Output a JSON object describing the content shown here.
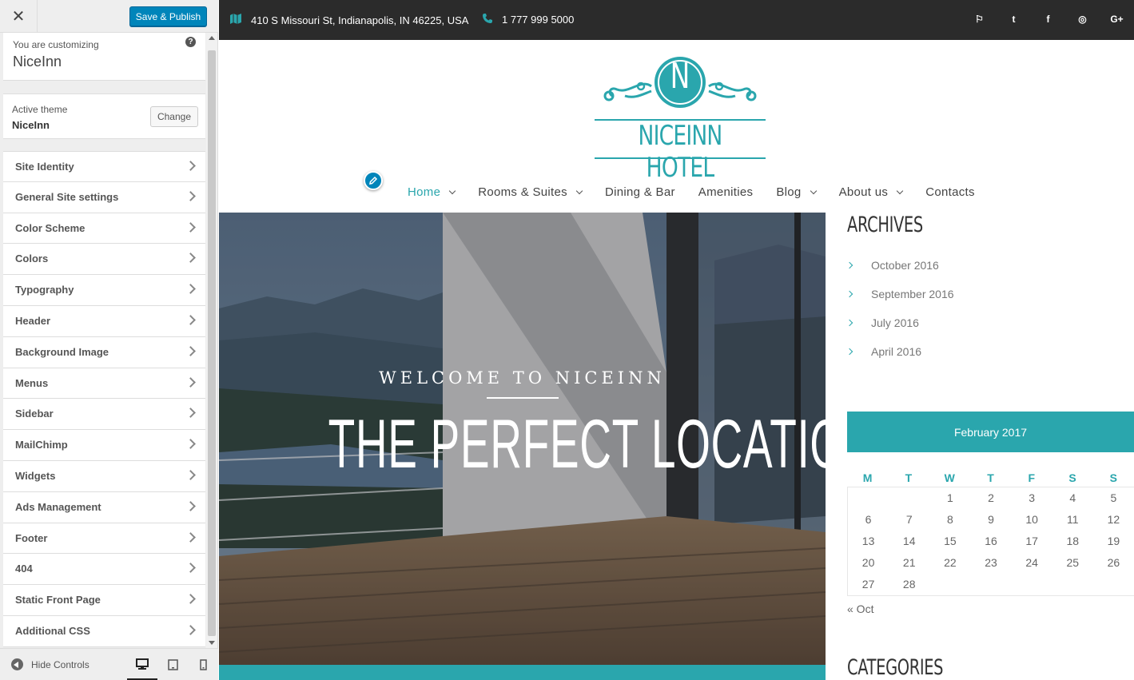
{
  "customizer": {
    "close_icon": "close-icon",
    "save_label": "Save & Publish",
    "info_subtitle": "You are customizing",
    "info_title": "NiceInn",
    "help_icon": "help-icon",
    "theme_subtitle": "Active theme",
    "theme_name": "NiceInn",
    "change_label": "Change",
    "sections": [
      {
        "label": "Site Identity"
      },
      {
        "label": "General Site settings"
      },
      {
        "label": "Color Scheme"
      },
      {
        "label": "Colors"
      },
      {
        "label": "Typography"
      },
      {
        "label": "Header"
      },
      {
        "label": "Background Image"
      },
      {
        "label": "Menus"
      },
      {
        "label": "Sidebar"
      },
      {
        "label": "MailChimp"
      },
      {
        "label": "Widgets"
      },
      {
        "label": "Ads Management"
      },
      {
        "label": "Footer"
      },
      {
        "label": "404"
      },
      {
        "label": "Static Front Page"
      },
      {
        "label": "Additional CSS"
      }
    ],
    "hide_controls_label": "Hide Controls",
    "devices": [
      "desktop-icon",
      "tablet-icon",
      "mobile-icon"
    ],
    "active_device": "desktop"
  },
  "site": {
    "address": "410 S Missouri St, Indianapolis, IN 46225, USA",
    "phone": "1 777 999 5000",
    "social_icons": [
      "foursquare-icon",
      "twitter-icon",
      "facebook-icon",
      "tripadvisor-icon",
      "google-plus-icon"
    ],
    "social_glyphs": [
      "⚐",
      "t",
      "f",
      "◎",
      "G+"
    ],
    "logo_letter": "N",
    "logo_text": "NICEINN HOTEL",
    "nav": [
      {
        "label": "Home",
        "dropdown": true,
        "active": true
      },
      {
        "label": "Rooms & Suites",
        "dropdown": true,
        "active": false
      },
      {
        "label": "Dining & Bar",
        "dropdown": false,
        "active": false
      },
      {
        "label": "Amenities",
        "dropdown": false,
        "active": false
      },
      {
        "label": "Blog",
        "dropdown": true,
        "active": false
      },
      {
        "label": "About us",
        "dropdown": true,
        "active": false
      },
      {
        "label": "Contacts",
        "dropdown": false,
        "active": false
      }
    ],
    "hero": {
      "welcome": "WELCOME TO NICEINN",
      "title": "THE PERFECT LOCATION"
    },
    "archives": {
      "title": "ARCHIVES",
      "items": [
        "October 2016",
        "September 2016",
        "July 2016",
        "April 2016"
      ]
    },
    "calendar": {
      "caption": "February 2017",
      "days": [
        "M",
        "T",
        "W",
        "T",
        "F",
        "S",
        "S"
      ],
      "rows": [
        [
          "",
          "",
          "1",
          "2",
          "3",
          "4",
          "5"
        ],
        [
          "6",
          "7",
          "8",
          "9",
          "10",
          "11",
          "12"
        ],
        [
          "13",
          "14",
          "15",
          "16",
          "17",
          "18",
          "19"
        ],
        [
          "20",
          "21",
          "22",
          "23",
          "24",
          "25",
          "26"
        ],
        [
          "27",
          "28",
          "",
          "",
          "",
          "",
          ""
        ]
      ],
      "prev_label": "« Oct"
    },
    "categories_title": "CATEGORIES"
  },
  "colors": {
    "accent": "#2aa6ad",
    "wp_blue": "#0085ba",
    "topbar": "#2b2b2b"
  }
}
